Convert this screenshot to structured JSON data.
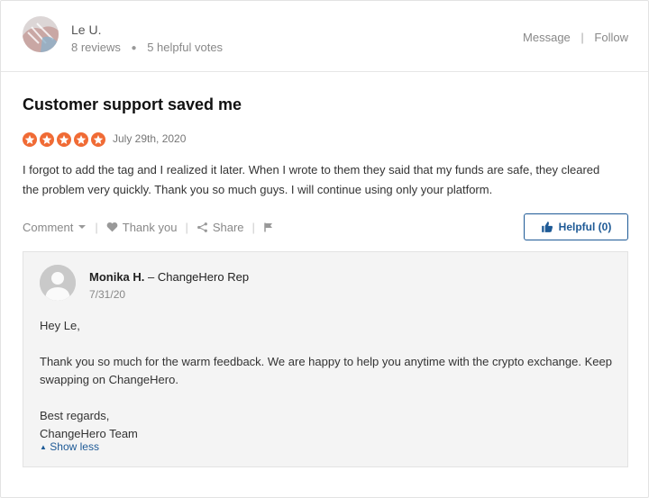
{
  "reviewer": {
    "name": "Le U.",
    "reviews": "8 reviews",
    "helpful_votes": "5 helpful votes",
    "message_label": "Message",
    "follow_label": "Follow"
  },
  "review": {
    "title": "Customer support saved me",
    "rating": 5,
    "date": "July 29th, 2020",
    "body": "I forgot to add the tag and I realized it later. When I wrote to them they said that my funds are safe, they cleared the problem very quickly. Thank you so much guys. I will continue using only your platform."
  },
  "actions": {
    "comment_label": "Comment",
    "thank_label": "Thank you",
    "share_label": "Share",
    "helpful_label": "Helpful (0)"
  },
  "reply": {
    "author": "Monika H.",
    "role": "– ChangeHero Rep",
    "date": "7/31/20",
    "greeting": "Hey Le,",
    "message": "Thank you so much for the warm feedback. We are happy to help you anytime with the crypto exchange. Keep swapping on ChangeHero.",
    "signoff": "Best regards,",
    "signature": "ChangeHero Team",
    "show_less_label": "Show less"
  },
  "colors": {
    "star": "#f06b35",
    "link_blue": "#1e5a96"
  }
}
